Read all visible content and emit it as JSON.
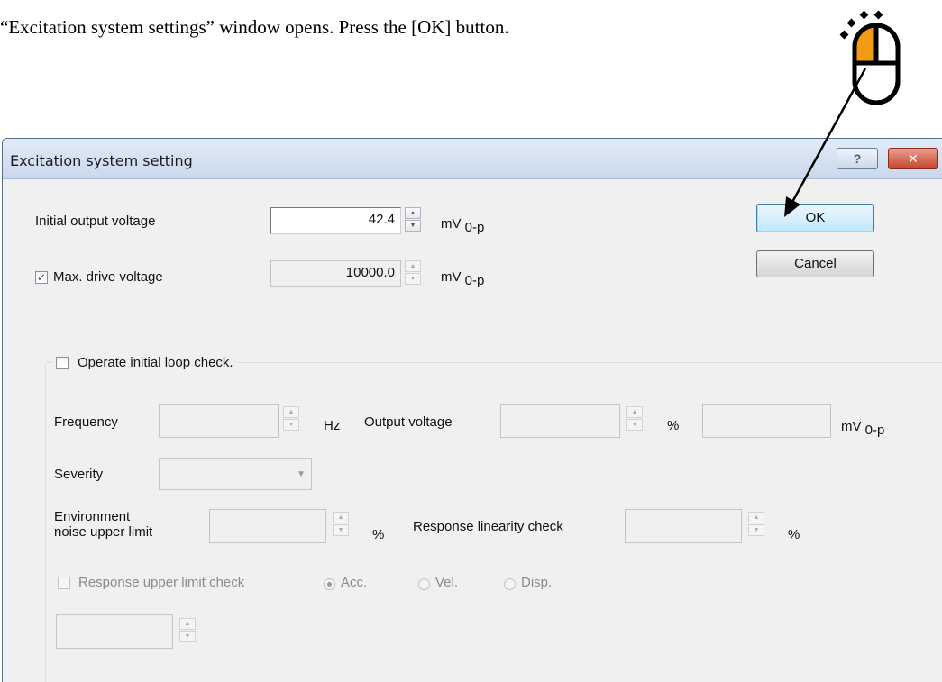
{
  "instruction": "“Excitation system settings” window opens. Press the [OK] button.",
  "icons": {
    "mouse": "mouse-left-click-icon",
    "pointer": "arrow-pointer-line"
  },
  "colors": {
    "mouse_left_button": "#f39a12",
    "close_button": "#c8442e",
    "titlebar": "#c9d8ec"
  },
  "dialog": {
    "title": "Excitation system setting",
    "help_glyph": "?",
    "close_glyph": "✕",
    "initial_output_voltage": {
      "label": "Initial output voltage",
      "value": "42.4",
      "unit": "mV",
      "unit_sub": "0-p"
    },
    "max_drive_voltage": {
      "checked": true,
      "check_glyph": "✓",
      "label": "Max. drive voltage",
      "value": "10000.0",
      "unit": "mV",
      "unit_sub": "0-p"
    },
    "buttons": {
      "ok": "OK",
      "cancel": "Cancel"
    },
    "loop_check": {
      "checked": false,
      "label": "Operate initial loop check.",
      "frequency": {
        "label": "Frequency",
        "value": "",
        "unit": "Hz"
      },
      "output_voltage": {
        "label": "Output voltage",
        "value": "",
        "unit_percent": "%",
        "mv_value": "",
        "unit": "mV",
        "unit_sub": "0-p"
      },
      "severity": {
        "label": "Severity",
        "selected": ""
      },
      "environment_noise": {
        "label_line1": "Environment",
        "label_line2": "noise upper limit",
        "value": "",
        "unit": "%"
      },
      "response_linearity": {
        "label": "Response linearity check",
        "value": "",
        "unit": "%"
      },
      "response_upper_limit": {
        "label": "Response upper limit check",
        "checked": false,
        "options": [
          "Acc.",
          "Vel.",
          "Disp."
        ],
        "selected": "Acc.",
        "value": ""
      }
    }
  }
}
